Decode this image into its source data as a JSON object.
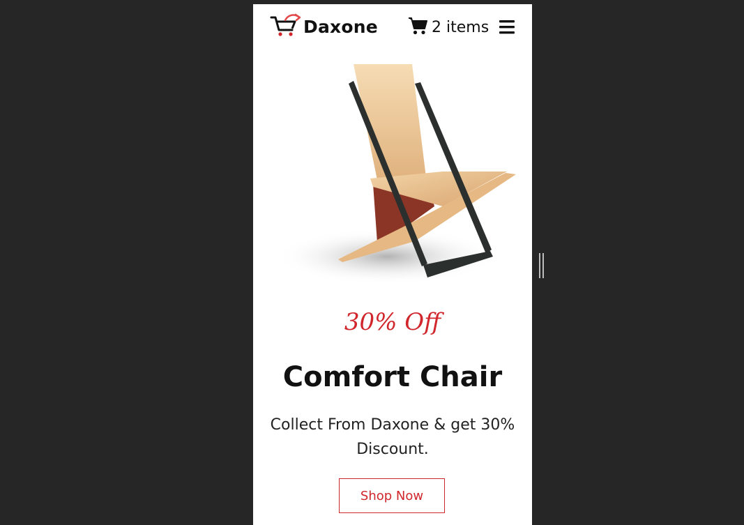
{
  "header": {
    "logo_text": "Daxone",
    "cart_label": "2 items",
    "icons": {
      "logo": "shopping-cart-logo-icon",
      "cart": "cart-icon",
      "menu": "hamburger-menu-icon"
    }
  },
  "hero": {
    "discount": "30% Off",
    "title": "Comfort Chair",
    "description": "Collect From Daxone & get 30% Discount.",
    "cta_label": "Shop Now",
    "image": "wooden-chair-image"
  },
  "colors": {
    "accent": "#d0262c",
    "background": "#262626",
    "panel": "#ffffff"
  }
}
